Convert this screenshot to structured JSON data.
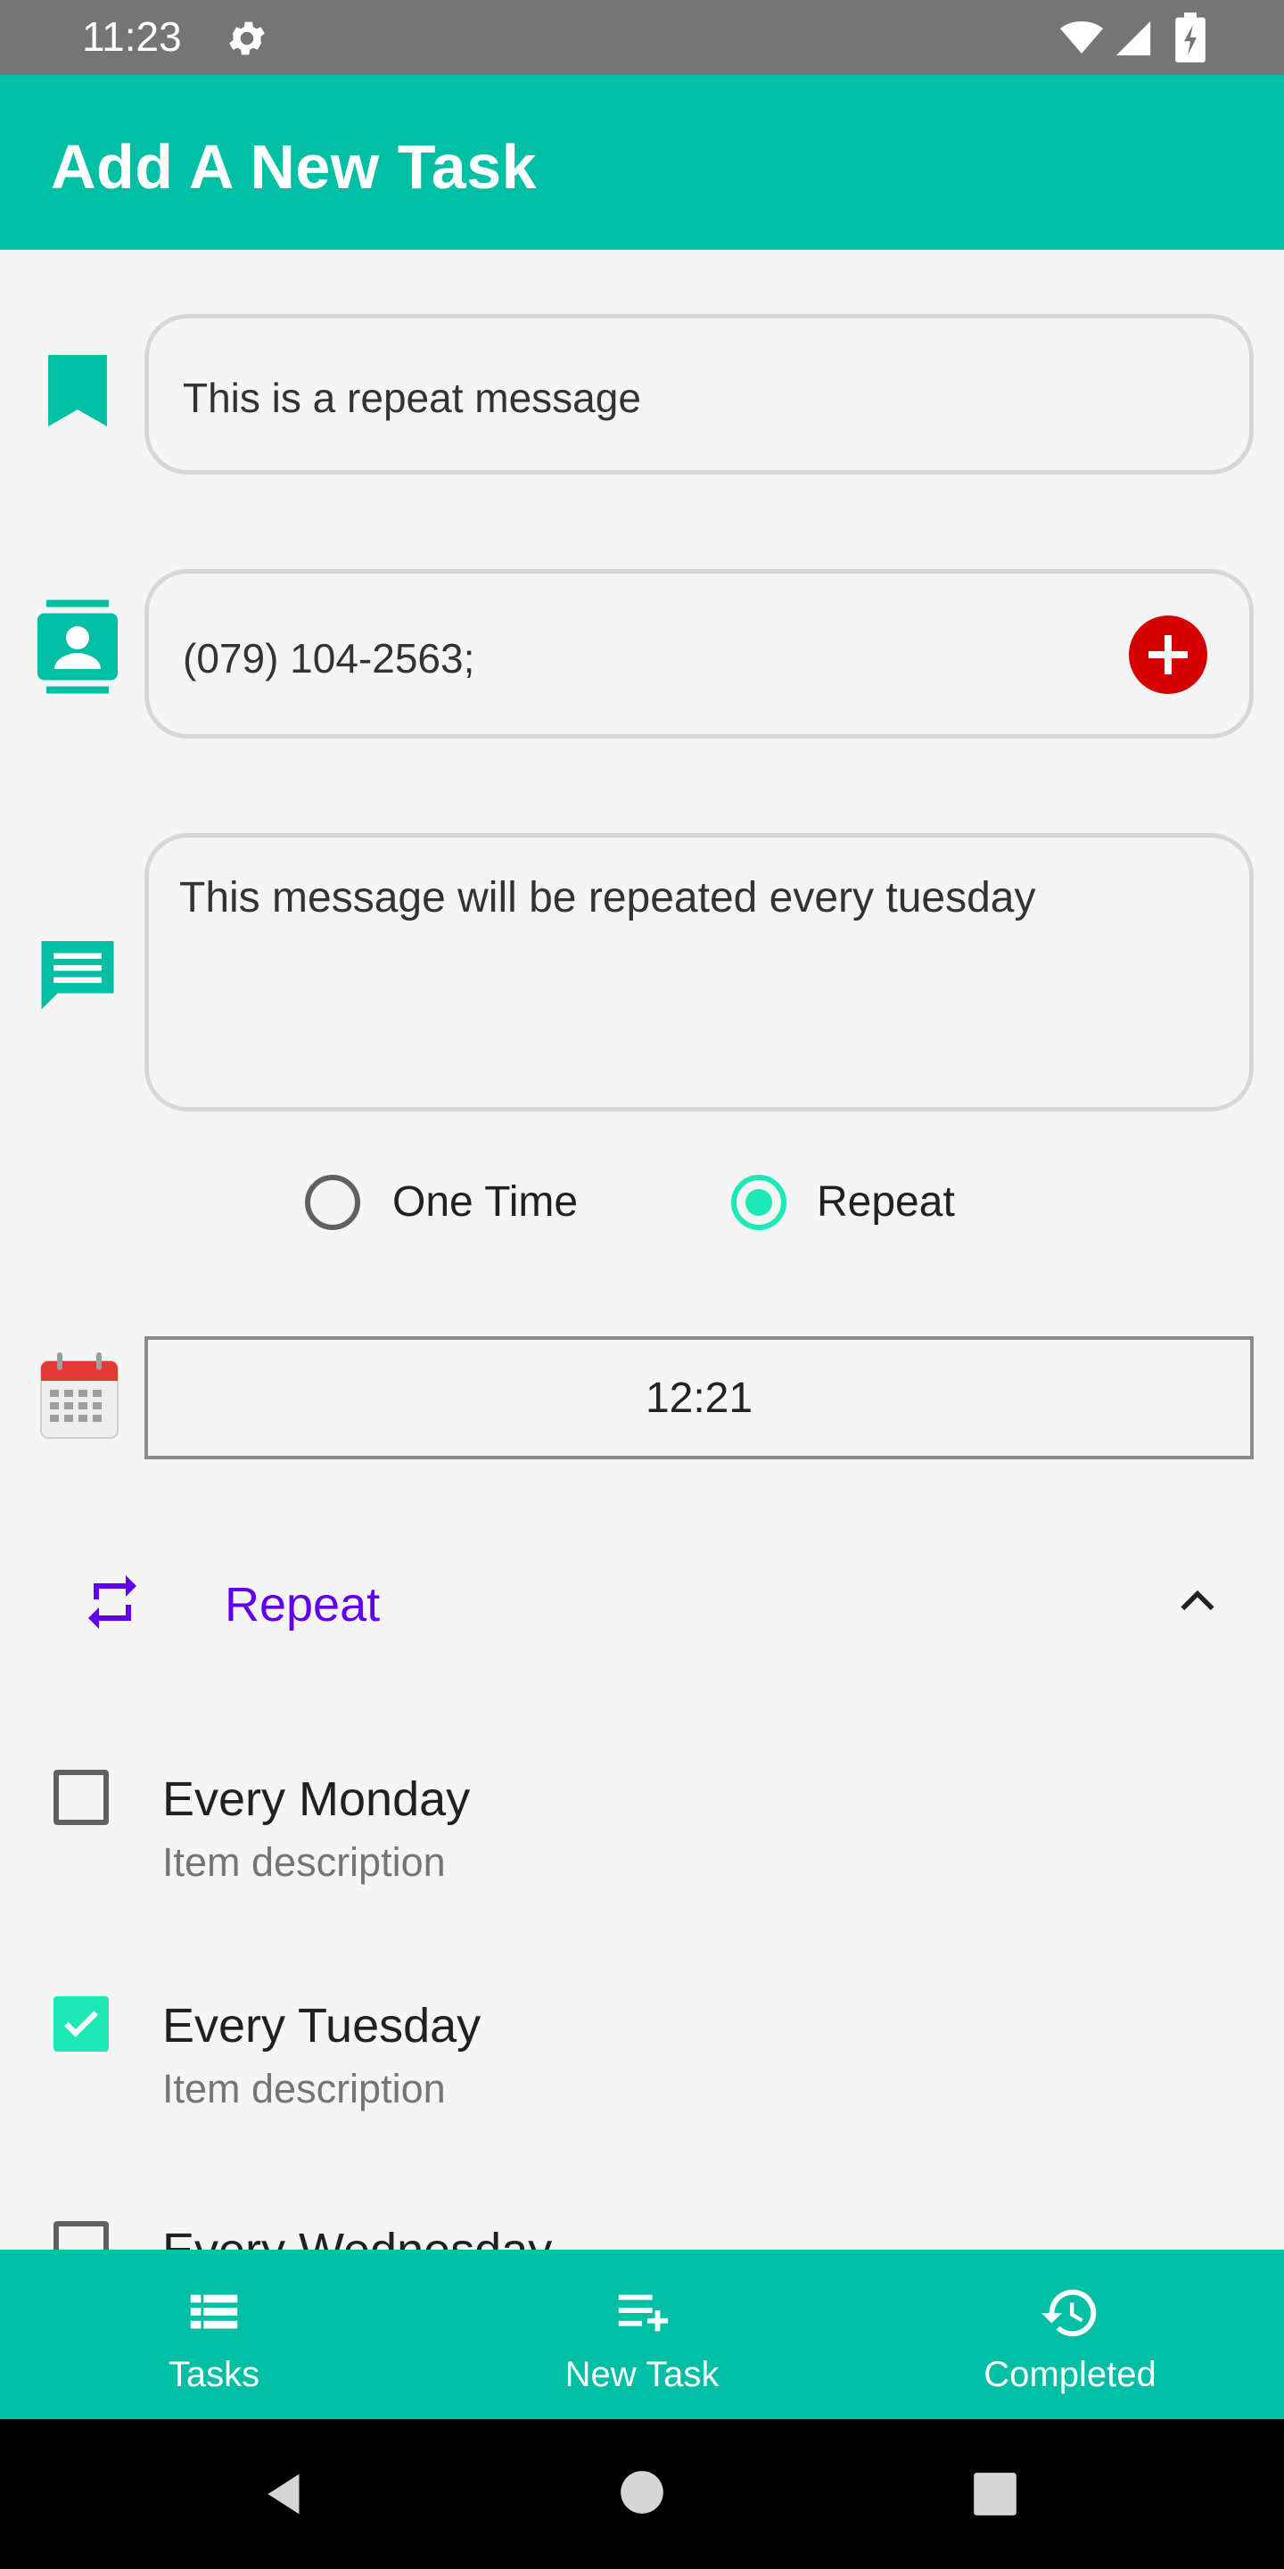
{
  "status_bar": {
    "time": "11:23"
  },
  "app_bar": {
    "title": "Add A New Task"
  },
  "form": {
    "title_value": "This is a repeat message",
    "contact_value": "(079) 104-2563;",
    "message_value": "This message will be repeated every tuesday",
    "schedule_type": {
      "options": [
        "One Time",
        "Repeat"
      ],
      "selected": "Repeat"
    },
    "time_value": "12:21"
  },
  "repeat_section": {
    "title": "Repeat",
    "expanded": true,
    "items": [
      {
        "label": "Every Monday",
        "description": "Item description",
        "checked": false
      },
      {
        "label": "Every Tuesday",
        "description": "Item description",
        "checked": true
      },
      {
        "label": "Every Wednesday",
        "description": "",
        "checked": false
      }
    ]
  },
  "bottom_nav": {
    "items": [
      {
        "label": "Tasks",
        "icon": "list-icon"
      },
      {
        "label": "New Task",
        "icon": "playlist-add-icon"
      },
      {
        "label": "Completed",
        "icon": "history-icon"
      }
    ]
  },
  "colors": {
    "primary": "#00bfa5",
    "accent": "#1de9b6",
    "repeat_purple": "#6200ea",
    "add_red": "#d50000",
    "status_bar": "#757575"
  }
}
